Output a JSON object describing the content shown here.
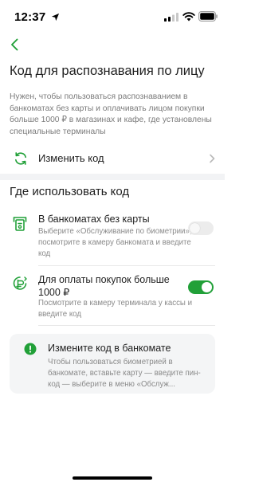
{
  "status_bar": {
    "time": "12:37"
  },
  "header": {
    "back_icon": "chevron-left-icon",
    "title": "Код для распознавания по лицу",
    "description": "Нужен, чтобы пользоваться распознаванием в банкоматах без карты и оплачивать лицом покупки больше 1000 ₽ в магазинах и кафе, где установлены специальные терминалы"
  },
  "change_code": {
    "icon": "refresh-icon",
    "label": "Изменить код"
  },
  "usage": {
    "section_title": "Где использовать код",
    "atm": {
      "icon": "atm-icon",
      "title": "В банкоматах без карты",
      "subtitle": "Выберите «Обслуживание по биометрии», посмотрите в камеру банкомата и введите код",
      "enabled": false
    },
    "purchases": {
      "icon": "face-payment-icon",
      "title": "Для оплаты покупок больше 1000 ₽",
      "subtitle": "Посмотрите в камеру терминала у кассы и введите код",
      "enabled": true
    }
  },
  "info": {
    "icon": "warning-icon",
    "title": "Измените код в банкомате",
    "body": "Чтобы пользоваться биометрией в банкомате, вставьте карту — введите пин-код — выберите в меню «Обслуж..."
  },
  "colors": {
    "accent": "#21a038",
    "text": "#1f1f1f",
    "muted": "#8a8a8a",
    "card_bg": "#f4f5f6"
  }
}
